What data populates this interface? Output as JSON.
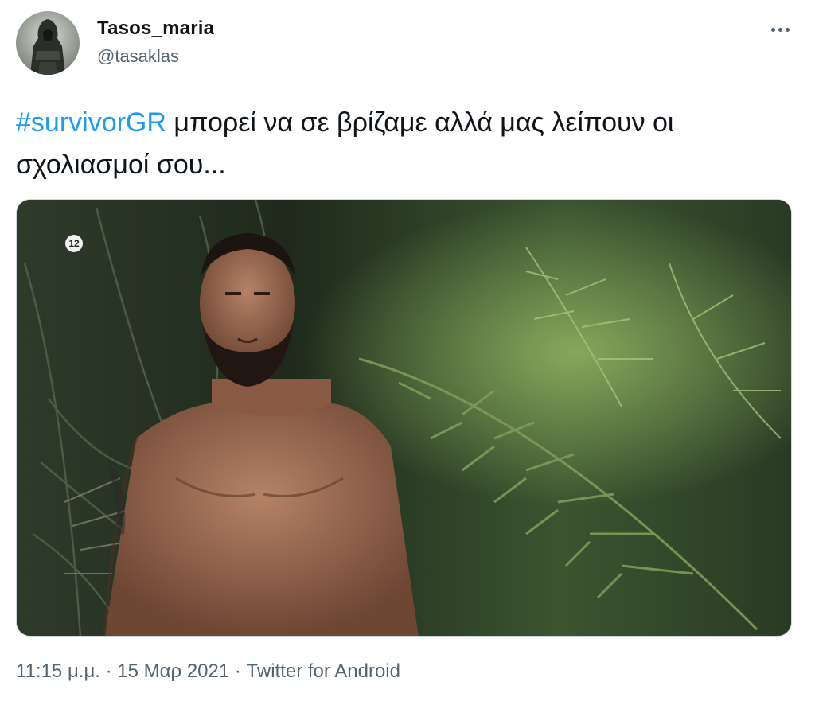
{
  "tweet": {
    "author": {
      "display_name": "Tasos_maria",
      "handle": "@tasaklas",
      "avatar_icon": "hooded-assassin-avatar"
    },
    "more_icon": "more-horizontal-icon",
    "text": {
      "hashtag": "#survivorGR",
      "body": " μπορεί να σε βρίζαμε αλλά μας λείπουν οι σχολιασμοί σου..."
    },
    "media": {
      "type": "image",
      "rating_badge": "12"
    },
    "meta": {
      "time": "11:15 μ.μ.",
      "separator": " · ",
      "date": "15 Μαρ 2021",
      "source": "Twitter for Android"
    }
  },
  "colors": {
    "link": "#1d9bf0",
    "secondary_text": "#536471",
    "primary_text": "#0f1419"
  }
}
